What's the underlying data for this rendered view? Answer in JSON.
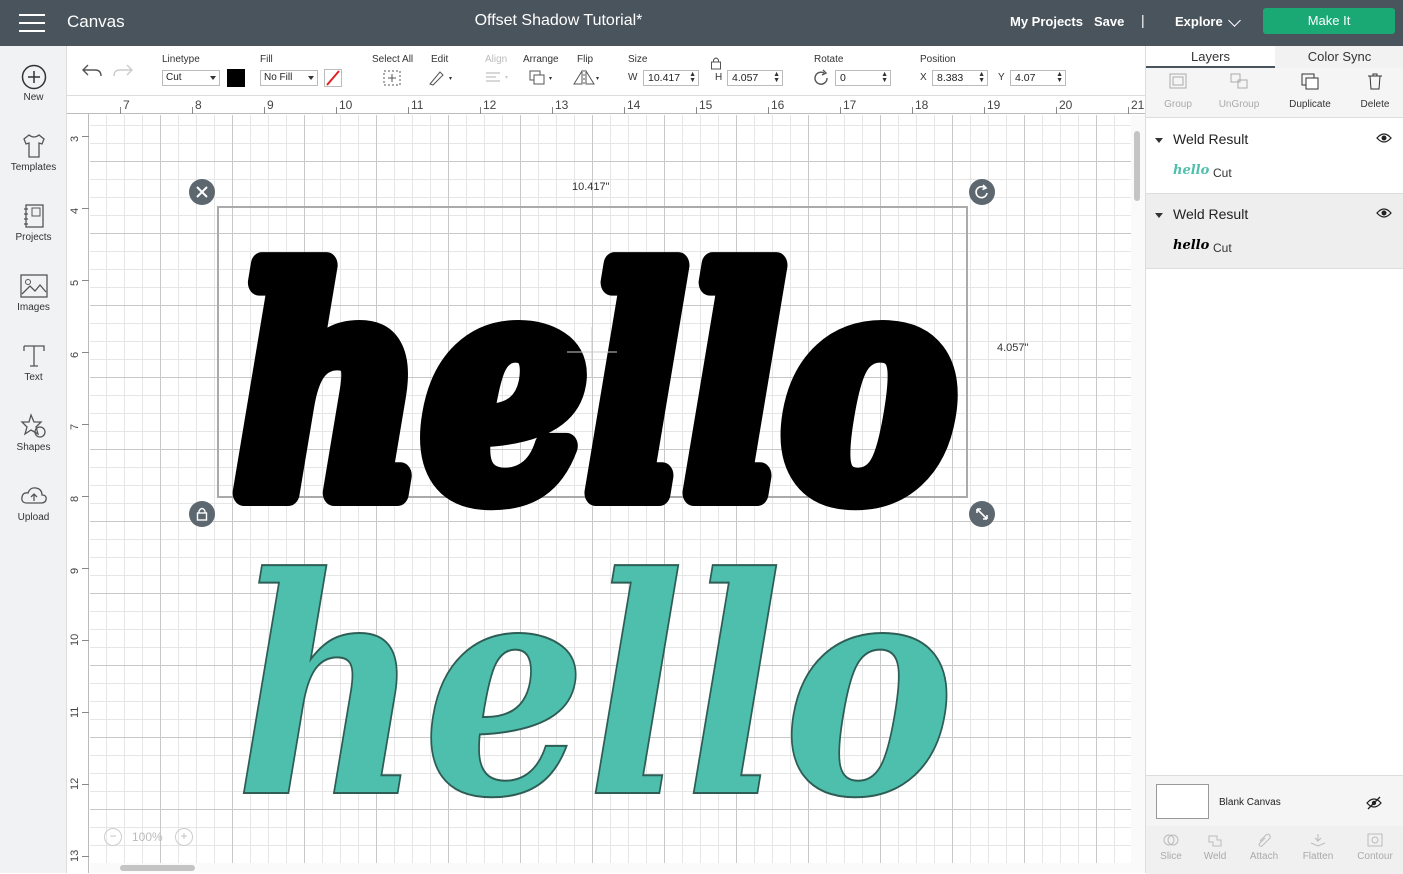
{
  "topbar": {
    "app_title": "Canvas",
    "doc_title": "Offset Shadow Tutorial*",
    "my_projects": "My Projects",
    "save": "Save",
    "separator": "|",
    "explore": "Explore",
    "make_it": "Make It"
  },
  "leftnav": {
    "items": [
      {
        "label": "New",
        "icon": "plus-circle-icon"
      },
      {
        "label": "Templates",
        "icon": "tshirt-icon"
      },
      {
        "label": "Projects",
        "icon": "projects-icon"
      },
      {
        "label": "Images",
        "icon": "image-icon"
      },
      {
        "label": "Text",
        "icon": "text-icon"
      },
      {
        "label": "Shapes",
        "icon": "shapes-icon"
      },
      {
        "label": "Upload",
        "icon": "upload-cloud-icon"
      }
    ]
  },
  "toolbar": {
    "linetype_label": "Linetype",
    "linetype_value": "Cut",
    "fill_label": "Fill",
    "fill_value": "No Fill",
    "select_all_label": "Select All",
    "edit_label": "Edit",
    "align_label": "Align",
    "arrange_label": "Arrange",
    "flip_label": "Flip",
    "size_label": "Size",
    "w_label": "W",
    "w_value": "10.417",
    "h_label": "H",
    "h_value": "4.057",
    "rotate_label": "Rotate",
    "rotate_value": "0",
    "position_label": "Position",
    "x_label": "X",
    "x_value": "8.383",
    "y_label": "Y",
    "y_value": "4.07",
    "linetype_color": "#000000"
  },
  "ruler": {
    "top": [
      "7",
      "8",
      "9",
      "10",
      "11",
      "12",
      "13",
      "14",
      "15",
      "16",
      "17",
      "18",
      "19",
      "20",
      "21"
    ],
    "left": [
      "3",
      "4",
      "5",
      "6",
      "7",
      "8",
      "9",
      "10",
      "11",
      "12",
      "13"
    ]
  },
  "canvas": {
    "width_label": "10.417\"",
    "height_label": "4.057\"",
    "zoom": "100%",
    "zoom_minus": "−",
    "zoom_plus": "+",
    "text_top": "hello",
    "text_bottom": "hello",
    "shadow_color": "#000000",
    "teal_color": "#4dbfac"
  },
  "layers_panel": {
    "tab_layers": "Layers",
    "tab_color_sync": "Color Sync",
    "tools": [
      "Group",
      "UnGroup",
      "Duplicate",
      "Delete"
    ],
    "groups": [
      {
        "title": "Weld Result",
        "child_label": "Cut",
        "thumb_text": "hello",
        "thumb_color": "#4dbfac"
      },
      {
        "title": "Weld Result",
        "child_label": "Cut",
        "thumb_text": "hello",
        "thumb_color": "#000000"
      }
    ],
    "blank_canvas": "Blank Canvas",
    "bottom_tools": [
      "Slice",
      "Weld",
      "Attach",
      "Flatten",
      "Contour"
    ]
  }
}
